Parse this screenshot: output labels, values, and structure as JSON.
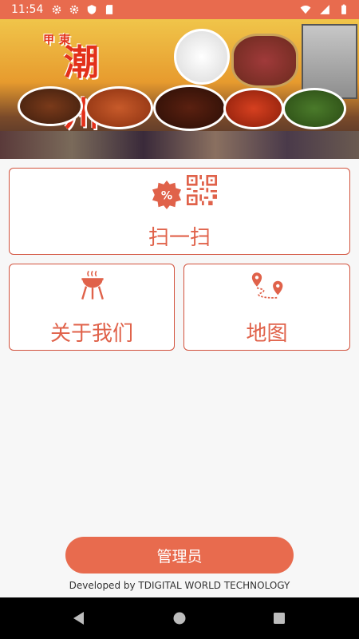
{
  "status_bar": {
    "time": "11:54",
    "left_icons": [
      "gear-icon",
      "gear-icon",
      "shield-icon",
      "sd-card-icon"
    ],
    "right_icons": [
      "wifi-icon",
      "signal-icon",
      "battery-icon"
    ]
  },
  "banner": {
    "brand_small": "東甲",
    "brand_main": "潮州粥"
  },
  "actions": {
    "scan_label": "扫一扫",
    "about_label": "关于我们",
    "map_label": "地图"
  },
  "admin": {
    "label": "管理员"
  },
  "footer": {
    "credit": "Developed by TDIGITAL WORLD TECHNOLOGY"
  },
  "colors": {
    "accent": "#e86b4e",
    "border": "#d2523d",
    "text_accent": "#e0624a"
  }
}
